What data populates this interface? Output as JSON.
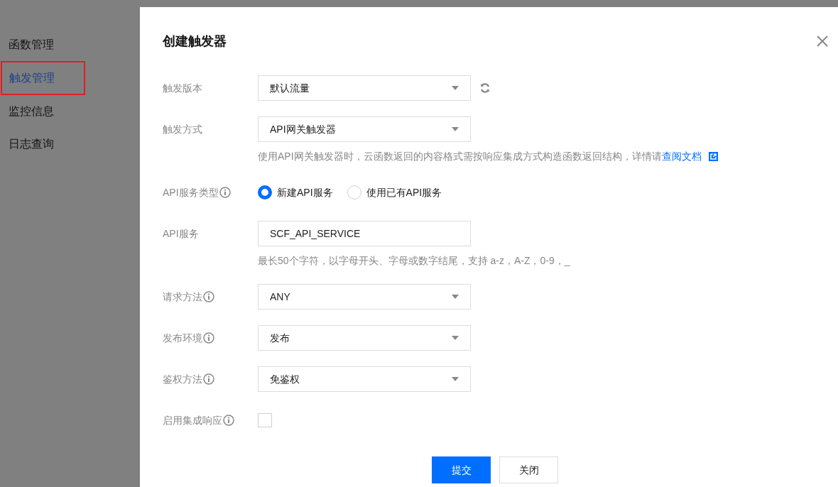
{
  "sidebar": {
    "items": [
      {
        "label": "函数管理",
        "selected": false
      },
      {
        "label": "触发管理",
        "selected": true
      },
      {
        "label": "监控信息",
        "selected": false
      },
      {
        "label": "日志查询",
        "selected": false
      }
    ]
  },
  "dialog": {
    "title": "创建触发器",
    "fields": [
      {
        "kind": "select",
        "label": "触发版本",
        "info": false,
        "value": "默认流量",
        "refresh": true
      },
      {
        "kind": "select",
        "label": "触发方式",
        "info": false,
        "value": "API网关触发器",
        "hint": "使用API网关触发器时，云函数返回的内容格式需按响应集成方式构造函数返回结构，详情请",
        "hint_link": "查阅文档"
      },
      {
        "kind": "radio",
        "label": "API服务类型",
        "info": true,
        "options": [
          {
            "label": "新建API服务",
            "selected": true
          },
          {
            "label": "使用已有API服务",
            "selected": false
          }
        ]
      },
      {
        "kind": "input",
        "label": "API服务",
        "info": false,
        "value": "SCF_API_SERVICE",
        "hint": "最长50个字符，以字母开头、字母或数字结尾，支持 a-z，A-Z，0-9，_"
      },
      {
        "kind": "select",
        "label": "请求方法",
        "info": true,
        "value": "ANY"
      },
      {
        "kind": "select",
        "label": "发布环境",
        "info": true,
        "value": "发布"
      },
      {
        "kind": "select",
        "label": "鉴权方法",
        "info": true,
        "value": "免鉴权"
      },
      {
        "kind": "checkbox",
        "label": "启用集成响应",
        "info": true,
        "checked": false
      }
    ],
    "buttons": [
      {
        "label": "提交",
        "primary": true
      },
      {
        "label": "关闭",
        "primary": false
      }
    ]
  }
}
